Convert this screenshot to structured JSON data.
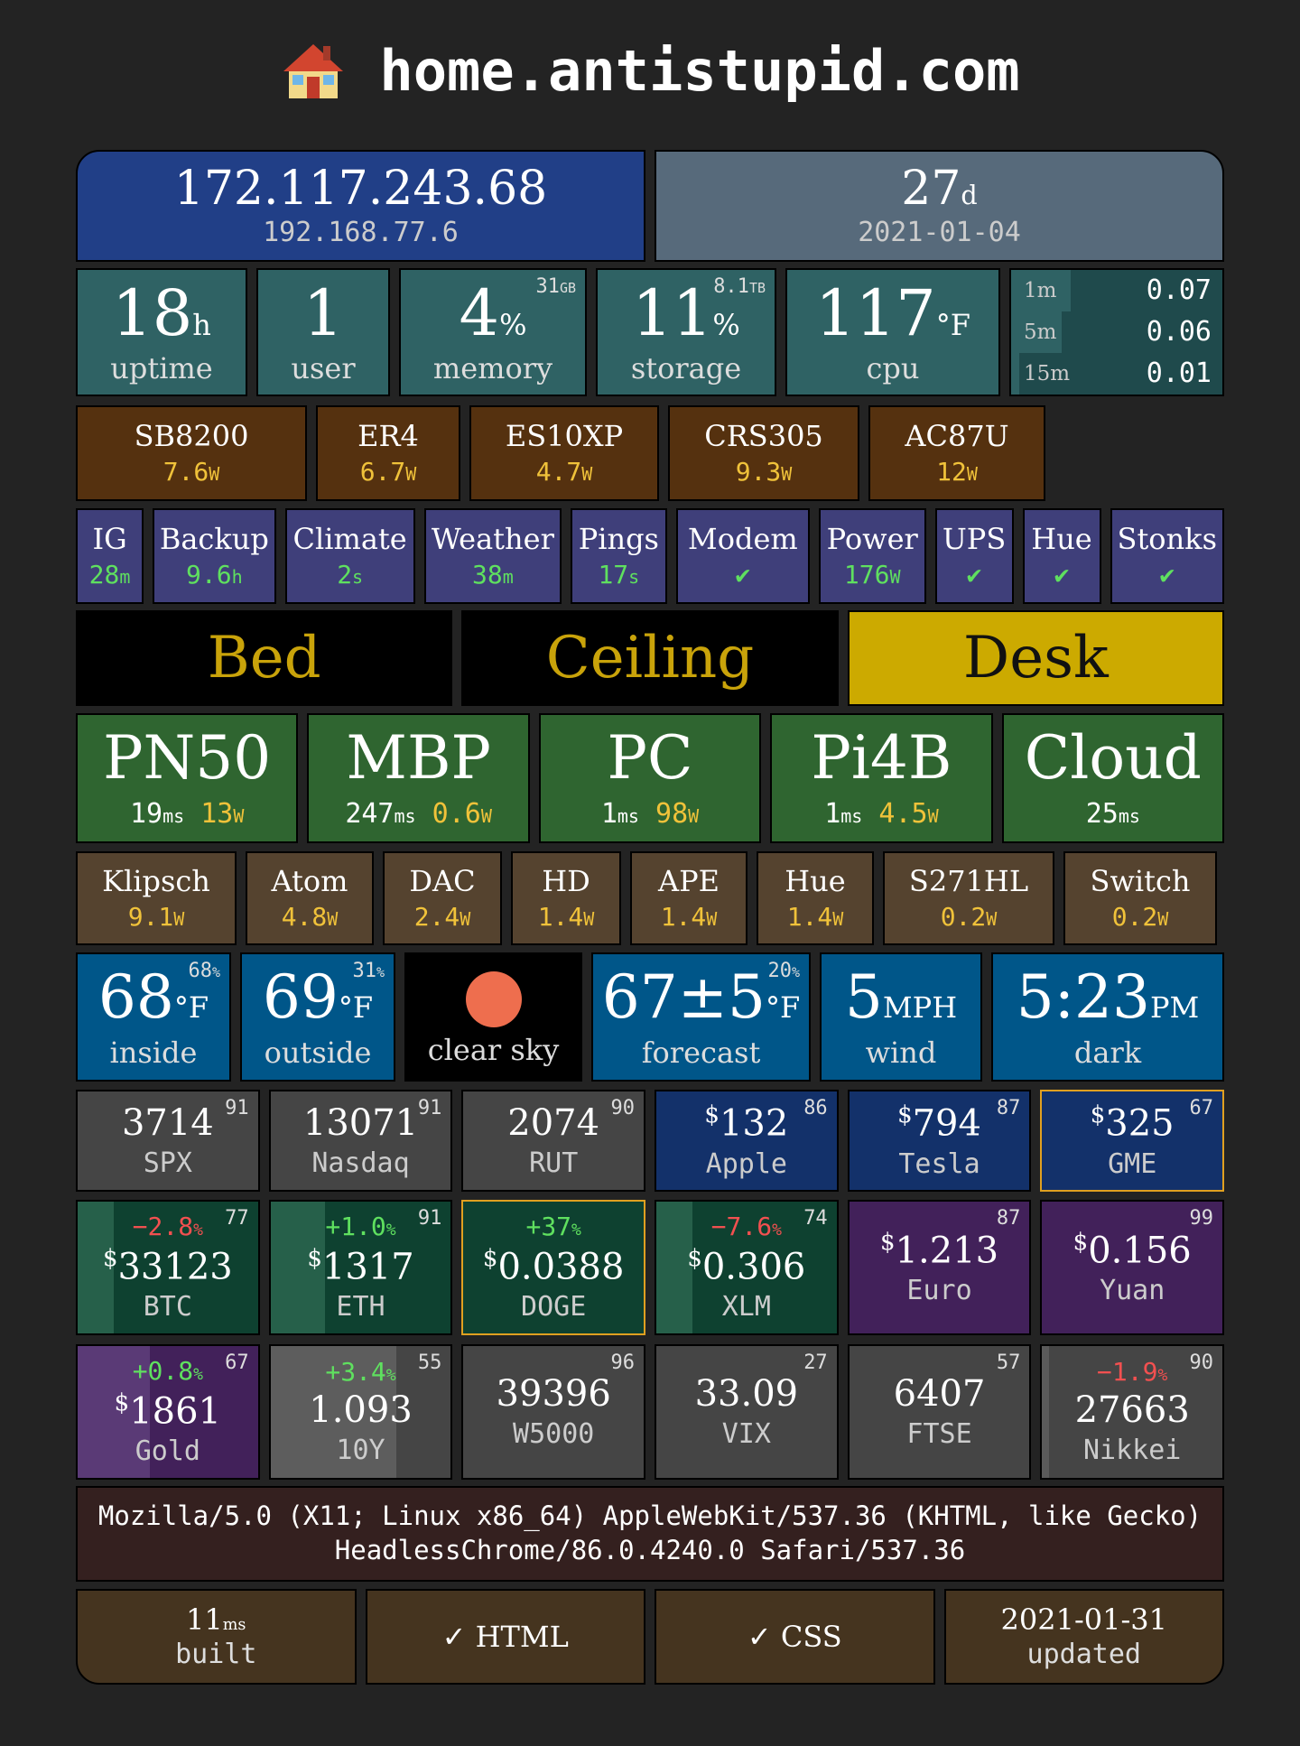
{
  "header": {
    "title": "home.antistupid.com",
    "icon": "house-icon"
  },
  "network": {
    "public_ip": "172.117.243.68",
    "local_ip": "192.168.77.6",
    "days_value": "27",
    "days_unit": "d",
    "date": "2021-01-04"
  },
  "system": {
    "uptime": {
      "value": "18",
      "unit": "h",
      "label": "uptime"
    },
    "users": {
      "value": "1",
      "label": "user"
    },
    "memory": {
      "value": "4",
      "unit": "%",
      "label": "memory",
      "total": "31",
      "total_unit": "GB"
    },
    "storage": {
      "value": "11",
      "unit": "%",
      "label": "storage",
      "total": "8.1",
      "total_unit": "TB"
    },
    "cpu": {
      "value": "117",
      "unit": "°F",
      "label": "cpu"
    },
    "load": [
      {
        "label": "1m",
        "value": "0.07",
        "fraction": 0.07
      },
      {
        "label": "5m",
        "value": "0.06",
        "fraction": 0.06
      },
      {
        "label": "15m",
        "value": "0.01",
        "fraction": 0.01
      }
    ]
  },
  "network_devices": [
    {
      "name": "SB8200",
      "power": "7.6",
      "unit": "W"
    },
    {
      "name": "ER4",
      "power": "6.7",
      "unit": "W"
    },
    {
      "name": "ES10XP",
      "power": "4.7",
      "unit": "W"
    },
    {
      "name": "CRS305",
      "power": "9.3",
      "unit": "W"
    },
    {
      "name": "AC87U",
      "power": "12",
      "unit": "W"
    }
  ],
  "services": [
    {
      "name": "IG",
      "value": "28",
      "unit": "m"
    },
    {
      "name": "Backup",
      "value": "9.6",
      "unit": "h"
    },
    {
      "name": "Climate",
      "value": "2",
      "unit": "s"
    },
    {
      "name": "Weather",
      "value": "38",
      "unit": "m"
    },
    {
      "name": "Pings",
      "value": "17",
      "unit": "s"
    },
    {
      "name": "Modem",
      "value": "✔",
      "unit": ""
    },
    {
      "name": "Power",
      "value": "176",
      "unit": "W"
    },
    {
      "name": "UPS",
      "value": "✔",
      "unit": ""
    },
    {
      "name": "Hue",
      "value": "✔",
      "unit": ""
    },
    {
      "name": "Stonks",
      "value": "✔",
      "unit": ""
    }
  ],
  "lights": [
    {
      "name": "Bed",
      "on": false
    },
    {
      "name": "Ceiling",
      "on": false
    },
    {
      "name": "Desk",
      "on": true
    }
  ],
  "hosts": [
    {
      "name": "PN50",
      "prefix": "",
      "ping": "19",
      "ping_unit": "ms",
      "power": "13",
      "power_unit": "W"
    },
    {
      "name": "MBP",
      "prefix": "",
      "ping": "247",
      "ping_unit": "ms",
      "power": "0.6",
      "power_unit": "W"
    },
    {
      "name": "PC",
      "prefix": "",
      "ping": "1",
      "ping_unit": "ms",
      "power": "98",
      "power_unit": "W"
    },
    {
      "name": "Pi4B",
      "prefix": "",
      "ping": "1",
      "ping_unit": "ms",
      "power": "4.5",
      "power_unit": "W"
    },
    {
      "name": "Cloud",
      "prefix": "",
      "ping": "25",
      "ping_unit": "ms",
      "power": "",
      "power_unit": ""
    }
  ],
  "outlets": [
    {
      "name": "Klipsch",
      "power": "9.1",
      "unit": "W"
    },
    {
      "name": "Atom",
      "power": "4.8",
      "unit": "W"
    },
    {
      "name": "DAC",
      "power": "2.4",
      "unit": "W"
    },
    {
      "name": "HD",
      "power": "1.4",
      "unit": "W"
    },
    {
      "name": "APE",
      "power": "1.4",
      "unit": "W"
    },
    {
      "name": "Hue",
      "power": "1.4",
      "unit": "W"
    },
    {
      "name": "S271HL",
      "power": "0.2",
      "unit": "W"
    },
    {
      "name": "Switch",
      "power": "0.2",
      "unit": "W"
    }
  ],
  "weather": {
    "inside": {
      "value": "68",
      "unit": "°F",
      "label": "inside",
      "humidity": "68",
      "humidity_unit": "%"
    },
    "outside": {
      "value": "69",
      "unit": "°F",
      "label": "outside",
      "humidity": "31",
      "humidity_unit": "%"
    },
    "sky": {
      "label": "clear sky",
      "icon": "sun-icon",
      "color": "#ee6e4e"
    },
    "forecast": {
      "value": "67±5",
      "unit": "°F",
      "label": "forecast",
      "precip": "20",
      "precip_unit": "%"
    },
    "wind": {
      "value": "5",
      "unit": "MPH",
      "label": "wind"
    },
    "sunset": {
      "value": "5:23",
      "unit": "PM",
      "label": "dark"
    }
  },
  "markets": {
    "row1": [
      {
        "label": "SPX",
        "value": "3714",
        "dollar": false,
        "score": "91"
      },
      {
        "label": "Nasdaq",
        "value": "13071",
        "dollar": false,
        "score": "91"
      },
      {
        "label": "RUT",
        "value": "2074",
        "dollar": false,
        "score": "90"
      },
      {
        "label": "Apple",
        "value": "132",
        "dollar": true,
        "score": "86"
      },
      {
        "label": "Tesla",
        "value": "794",
        "dollar": true,
        "score": "87"
      },
      {
        "label": "GME",
        "value": "325",
        "dollar": true,
        "score": "67"
      }
    ],
    "row2": [
      {
        "label": "BTC",
        "value": "33123",
        "dollar": true,
        "change": "−2.8",
        "change_unit": "%",
        "score": "77"
      },
      {
        "label": "ETH",
        "value": "1317",
        "dollar": true,
        "change": "+1.0",
        "change_unit": "%",
        "score": "91"
      },
      {
        "label": "DOGE",
        "value": "0.0388",
        "dollar": true,
        "change": "+37",
        "change_unit": "%",
        "score": ""
      },
      {
        "label": "XLM",
        "value": "0.306",
        "dollar": true,
        "change": "−7.6",
        "change_unit": "%",
        "score": "74"
      },
      {
        "label": "Euro",
        "value": "1.213",
        "dollar": true,
        "change": "",
        "change_unit": "",
        "score": "87"
      },
      {
        "label": "Yuan",
        "value": "0.156",
        "dollar": true,
        "change": "",
        "change_unit": "",
        "score": "99"
      }
    ],
    "row3": [
      {
        "label": "Gold",
        "value": "1861",
        "dollar": true,
        "change": "+0.8",
        "change_unit": "%",
        "score": "67"
      },
      {
        "label": "10Y",
        "value": "1.093",
        "dollar": false,
        "change": "+3.4",
        "change_unit": "%",
        "score": "55"
      },
      {
        "label": "W5000",
        "value": "39396",
        "dollar": false,
        "change": "",
        "change_unit": "",
        "score": "96"
      },
      {
        "label": "VIX",
        "value": "33.09",
        "dollar": false,
        "change": "",
        "change_unit": "",
        "score": "27"
      },
      {
        "label": "FTSE",
        "value": "6407",
        "dollar": false,
        "change": "",
        "change_unit": "",
        "score": "57"
      },
      {
        "label": "Nikkei",
        "value": "27663",
        "dollar": false,
        "change": "−1.9",
        "change_unit": "%",
        "score": "90"
      }
    ],
    "dollar_sign": "$"
  },
  "user_agent": "Mozilla/5.0 (X11; Linux x86_64) AppleWebKit/537.36 (KHTML, like Gecko) HeadlessChrome/86.0.4240.0 Safari/537.36",
  "footer": {
    "built_value": "11",
    "built_unit": "ms",
    "built_label": "built",
    "html": "✓ HTML",
    "css": "✓ CSS",
    "updated_date": "2021-01-31",
    "updated_label": "updated"
  }
}
